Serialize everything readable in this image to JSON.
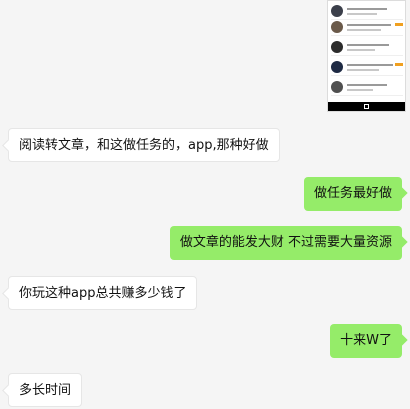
{
  "messages": [
    {
      "side": "in",
      "text": "阅读转文章，和这做任务的，app,那种好做"
    },
    {
      "side": "out",
      "text": "做任务最好做"
    },
    {
      "side": "out",
      "text": "做文章的能发大财 不过需要大量资源"
    },
    {
      "side": "in",
      "text": "你玩这种app总共赚多少钱了"
    },
    {
      "side": "out",
      "text": "十来W了"
    },
    {
      "side": "in",
      "text": "多长时间"
    }
  ],
  "colors": {
    "background": "#f5f5f5",
    "incoming_bubble": "#ffffff",
    "outgoing_bubble": "#95ec69"
  },
  "thumbnail": {
    "icon": "app-list-screenshot"
  }
}
